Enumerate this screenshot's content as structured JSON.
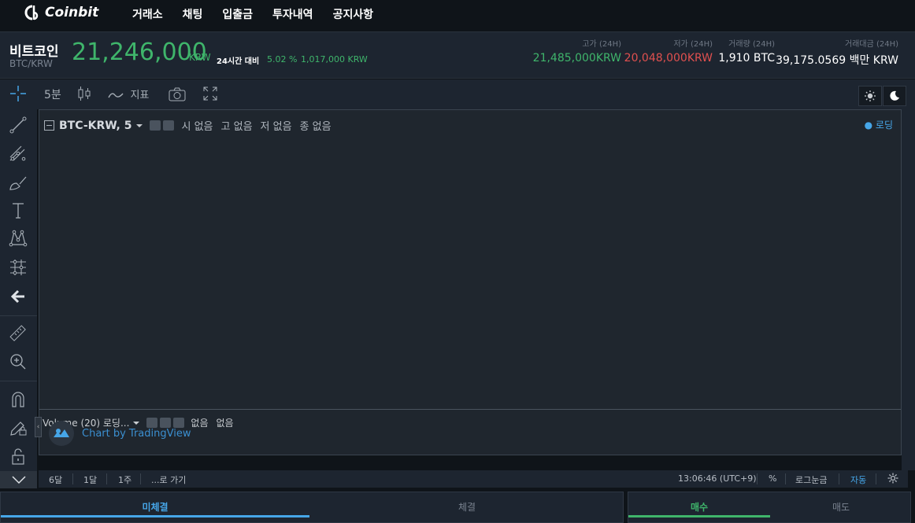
{
  "app": {
    "logo_text": "Coinbit"
  },
  "nav": [
    "거래소",
    "채팅",
    "입출금",
    "투자내역",
    "공지사항"
  ],
  "ticker": {
    "coin_name": "비트코인",
    "pair": "BTC/KRW",
    "price": "21,246,000",
    "price_unit": "KRW",
    "change_label": "24시간 대비",
    "change_pct": "5.02 %",
    "change_amt": "1,017,000 KRW",
    "high_label": "고가 (24H)",
    "high_value": "21,485,000KRW",
    "low_label": "저가 (24H)",
    "low_value": "20,048,000KRW",
    "volume_label": "거래량 (24H)",
    "volume_value": "1,910 BTC",
    "amount_label": "거래대금 (24H)",
    "amount_value": "39,175.0569 백만 KRW"
  },
  "chart_toolbar": {
    "interval": "5분",
    "indicators": "지표"
  },
  "chart": {
    "symbol": "BTC-KRW, 5",
    "ohlc": {
      "open": "시 없음",
      "high": "고 없음",
      "low": "저 없음",
      "close": "종 없음"
    },
    "loading": "● 로딩",
    "volume_label": "Volume (20) 로딩...",
    "volume_v1": "없음",
    "volume_v2": "없음",
    "attribution": "Chart by TradingView"
  },
  "bottom_bar": {
    "range_6m": "6달",
    "range_1m": "1달",
    "range_1w": "1주",
    "goto": "...로 가기",
    "time": "13:06:46 (UTC+9)",
    "percent": "%",
    "log": "로그눈금",
    "auto": "자동"
  },
  "order_tabs": {
    "unfilled": "미체결",
    "filled": "체결"
  },
  "trade_tabs": {
    "buy": "매수",
    "sell": "매도"
  },
  "colors": {
    "up": "#3fb56b",
    "down": "#e0504f",
    "accent": "#46a6e8"
  }
}
